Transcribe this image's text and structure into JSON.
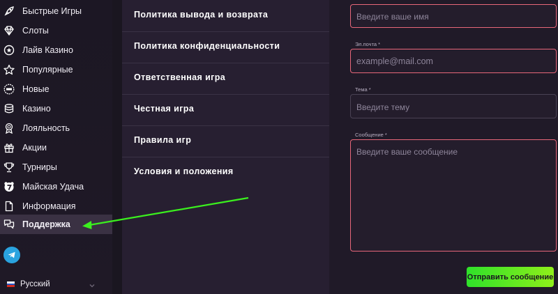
{
  "sidebar": {
    "items": [
      {
        "label": "Быстрые Игры",
        "icon": "rocket-icon"
      },
      {
        "label": "Слоты",
        "icon": "diamond-icon"
      },
      {
        "label": "Лайв Казино",
        "icon": "chip-icon"
      },
      {
        "label": "Популярные",
        "icon": "star-icon"
      },
      {
        "label": "Новые",
        "icon": "new-badge-icon"
      },
      {
        "label": "Казино",
        "icon": "coin-stack-icon"
      },
      {
        "label": "Лояльность",
        "icon": "medal-icon"
      },
      {
        "label": "Акции",
        "icon": "gift-icon"
      },
      {
        "label": "Турниры",
        "icon": "trophy-icon"
      },
      {
        "label": "Майская Удача",
        "icon": "lucky-seven-icon"
      },
      {
        "label": "Информация",
        "icon": "document-icon"
      },
      {
        "label": "Поддержка",
        "icon": "chat-icon",
        "active": true
      }
    ],
    "language": {
      "label": "Русский",
      "flag": "ru-flag-icon"
    },
    "telegram": {
      "icon": "telegram-icon",
      "color": "#2aa3df"
    }
  },
  "policies": [
    "Политика вывода и возврата",
    "Политика конфиденциальности",
    "Ответственная игра",
    "Честная игра",
    "Правила игр",
    "Условия и положения"
  ],
  "form": {
    "name": {
      "placeholder": "Введите ваше имя"
    },
    "email": {
      "label": "Эл.почта *",
      "placeholder": "example@mail.com"
    },
    "subject": {
      "label": "Тема *",
      "placeholder": "Введите тему"
    },
    "message": {
      "label": "Сообщение *",
      "placeholder": "Введите ваше сообщение"
    },
    "submit_label": "Отправить сообщение"
  },
  "colors": {
    "accent_green": "#2fe12a",
    "field_border": "#e8677a",
    "arrow": "#3bf01e"
  }
}
